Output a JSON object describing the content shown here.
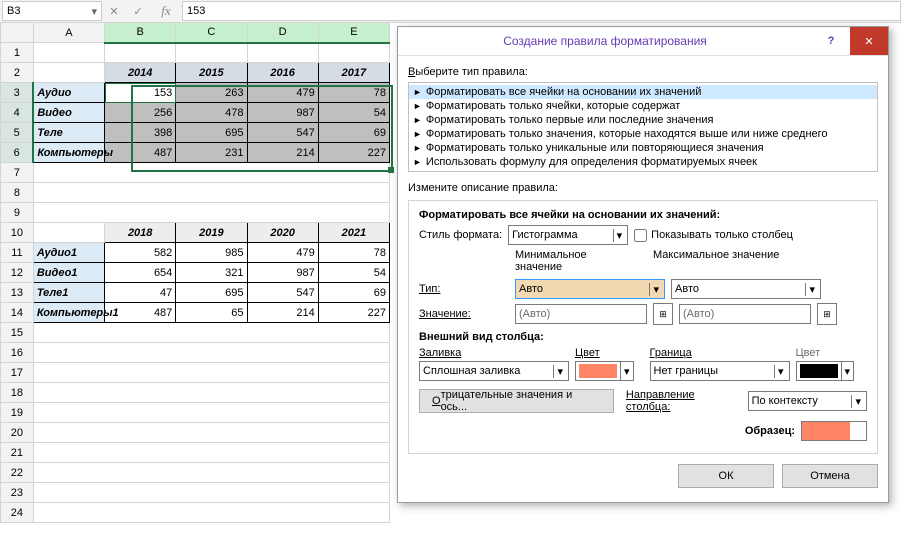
{
  "namebox": "B3",
  "formula_value": "153",
  "columns": [
    "A",
    "B",
    "C",
    "D",
    "E"
  ],
  "row_numbers": [
    1,
    2,
    3,
    4,
    5,
    6,
    7,
    8,
    9,
    10,
    11,
    12,
    13,
    14,
    15,
    16,
    17,
    18,
    19,
    20,
    21,
    22,
    23,
    24
  ],
  "table1": {
    "years": [
      "2014",
      "2015",
      "2016",
      "2017"
    ],
    "rows": [
      {
        "label": "Аудио",
        "v": [
          "153",
          "263",
          "479",
          "78"
        ]
      },
      {
        "label": "Видео",
        "v": [
          "256",
          "478",
          "987",
          "54"
        ]
      },
      {
        "label": "Теле",
        "v": [
          "398",
          "695",
          "547",
          "69"
        ]
      },
      {
        "label": "Компьютеры",
        "v": [
          "487",
          "231",
          "214",
          "227"
        ]
      }
    ]
  },
  "table2": {
    "years": [
      "2018",
      "2019",
      "2020",
      "2021"
    ],
    "rows": [
      {
        "label": "Аудио1",
        "v": [
          "582",
          "985",
          "479",
          "78"
        ]
      },
      {
        "label": "Видео1",
        "v": [
          "654",
          "321",
          "987",
          "54"
        ]
      },
      {
        "label": "Теле1",
        "v": [
          "47",
          "695",
          "547",
          "69"
        ]
      },
      {
        "label": "Компьютеры1",
        "v": [
          "487",
          "65",
          "214",
          "227"
        ]
      }
    ]
  },
  "dialog": {
    "title": "Создание правила форматирования",
    "select_type_label": "Выберите тип правила:",
    "rule_types": [
      "Форматировать все ячейки на основании их значений",
      "Форматировать только ячейки, которые содержат",
      "Форматировать только первые или последние значения",
      "Форматировать только значения, которые находятся выше или ниже среднего",
      "Форматировать только уникальные или повторяющиеся значения",
      "Использовать формулу для определения форматируемых ячеек"
    ],
    "edit_desc_label": "Измените описание правила:",
    "format_all_label": "Форматировать все ячейки на основании их значений:",
    "style_label": "Стиль формата:",
    "style_value": "Гистограмма",
    "show_bar_only": "Показывать только столбец",
    "min_label": "Минимальное значение",
    "max_label": "Максимальное значение",
    "type_label": "Тип:",
    "type_min": "Авто",
    "type_max": "Авто",
    "value_label": "Значение:",
    "value_min": "(Авто)",
    "value_max": "(Авто)",
    "appearance_label": "Внешний вид столбца:",
    "fill_label": "Заливка",
    "fill_value": "Сплошная заливка",
    "color_label": "Цвет",
    "fill_color": "#ff8566",
    "border_label": "Граница",
    "border_value": "Нет границы",
    "border_color_label": "Цвет",
    "border_color": "#000000",
    "neg_button": "Отрицательные значения и ось...",
    "dir_label": "Направление столбца:",
    "dir_value": "По контексту",
    "preview_label": "Образец:",
    "ok": "ОК",
    "cancel": "Отмена"
  }
}
